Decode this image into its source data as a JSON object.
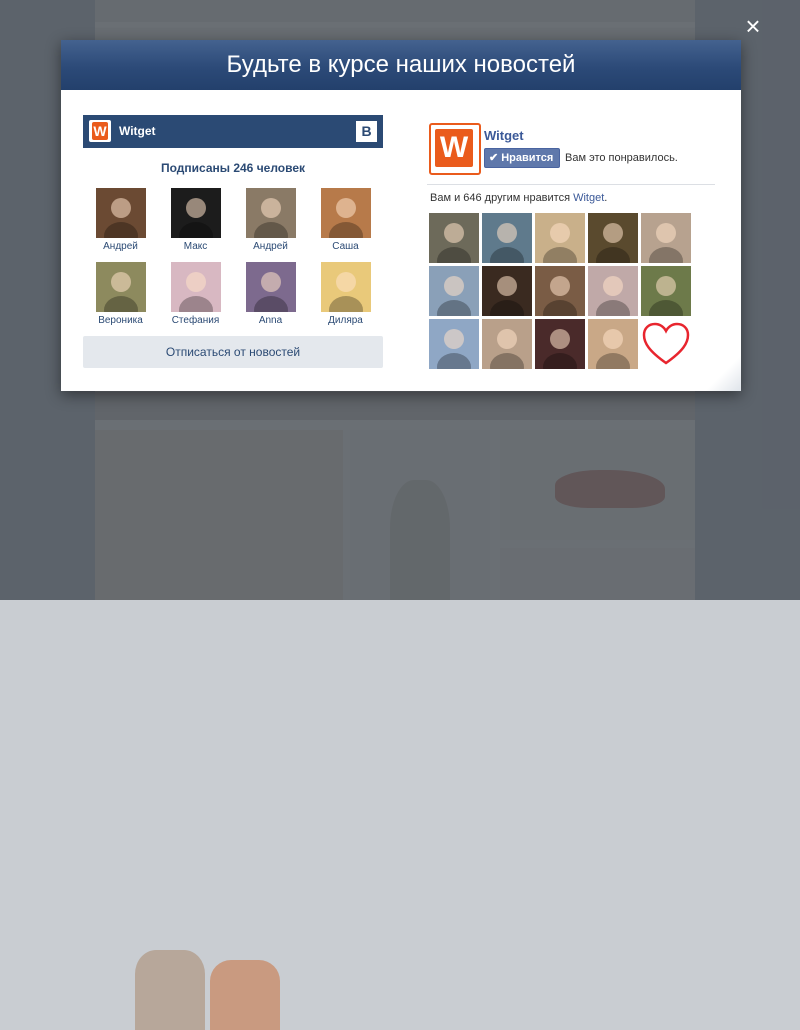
{
  "modal": {
    "title": "Будьте в курсе наших новостей",
    "close_symbol": "×"
  },
  "vk_widget": {
    "logo_letter": "W",
    "group_name": "Witget",
    "network_badge": "В",
    "subscribers_text": "Подписаны 246 человек",
    "members": [
      {
        "name": "Андрей",
        "color": "#6b4a33"
      },
      {
        "name": "Макс",
        "color": "#1c1c1c"
      },
      {
        "name": "Андрей",
        "color": "#8a7a66"
      },
      {
        "name": "Саша",
        "color": "#b77a4a"
      },
      {
        "name": "Вероника",
        "color": "#8d8a5e"
      },
      {
        "name": "Стефания",
        "color": "#d8b8c2"
      },
      {
        "name": "Anna",
        "color": "#7d6a8e"
      },
      {
        "name": "Диляра",
        "color": "#e9c97a"
      }
    ],
    "unsubscribe_label": "Отписаться от новостей"
  },
  "fb_widget": {
    "logo_letter": "W",
    "page_name": "Witget",
    "like_button_label": "Нравится",
    "liked_text": "Вам это понравилось.",
    "count_prefix": "Вам и 646 другим нравится ",
    "count_link": "Witget",
    "count_suffix": ".",
    "faces": [
      {
        "color": "#6d6a5a"
      },
      {
        "color": "#5f7a8c"
      },
      {
        "color": "#c9b08a"
      },
      {
        "color": "#5a4a2e"
      },
      {
        "color": "#b7a28f"
      },
      {
        "color": "#8aa0b8"
      },
      {
        "color": "#3a2a20"
      },
      {
        "color": "#7a5c45"
      },
      {
        "color": "#c0a9a8"
      },
      {
        "color": "#6d7a4a"
      },
      {
        "color": "#8fa7c5"
      },
      {
        "color": "#b9a08a"
      },
      {
        "color": "#4a2a2a"
      },
      {
        "color": "#c9a887"
      }
    ],
    "heart_color": "#e8252e"
  }
}
